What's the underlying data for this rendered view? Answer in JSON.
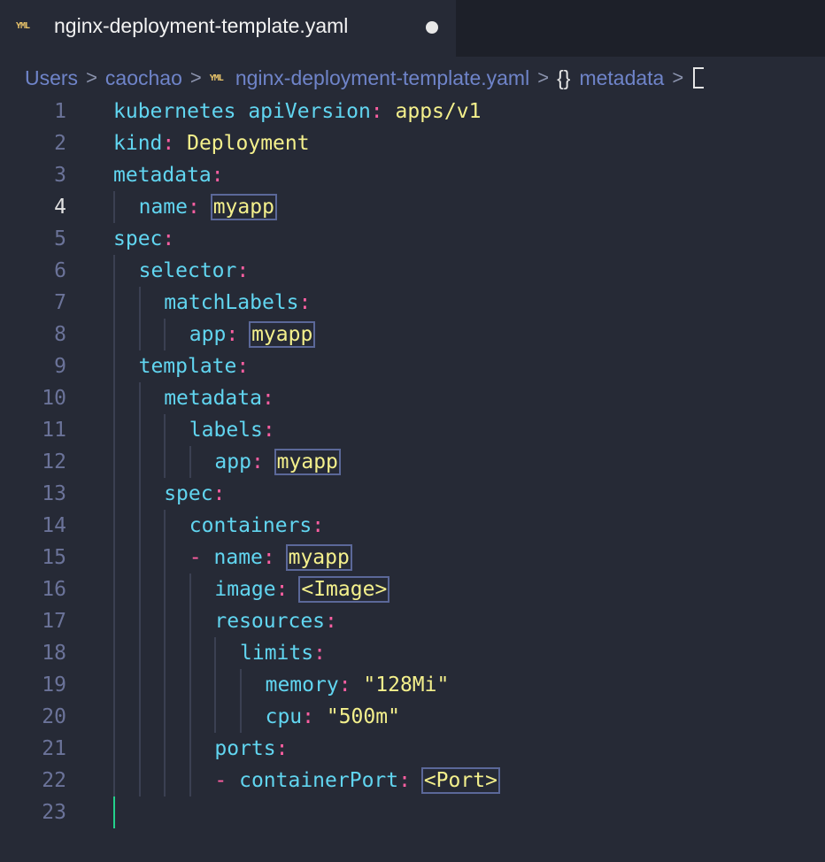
{
  "tab": {
    "icon_text": "YML",
    "title": "nginx-deployment-template.yaml"
  },
  "breadcrumb": {
    "items": [
      "Users",
      "caochao",
      "nginx-deployment-template.yaml",
      "metadata"
    ],
    "file_icon_text": "YML",
    "object_icon_text": "{}"
  },
  "editor": {
    "active_line": 4,
    "lines": [
      {
        "num": "1",
        "indent": 0,
        "key": "kubernetes apiVersion",
        "val": "apps/v1"
      },
      {
        "num": "2",
        "indent": 0,
        "key": "kind",
        "val": "Deployment"
      },
      {
        "num": "3",
        "indent": 0,
        "key": "metadata"
      },
      {
        "num": "4",
        "indent": 1,
        "key": "name",
        "val": "myapp",
        "hl": true
      },
      {
        "num": "5",
        "indent": 0,
        "key": "spec"
      },
      {
        "num": "6",
        "indent": 1,
        "key": "selector"
      },
      {
        "num": "7",
        "indent": 2,
        "key": "matchLabels"
      },
      {
        "num": "8",
        "indent": 3,
        "key": "app",
        "val": "myapp",
        "hl": true
      },
      {
        "num": "9",
        "indent": 1,
        "key": "template"
      },
      {
        "num": "10",
        "indent": 2,
        "key": "metadata"
      },
      {
        "num": "11",
        "indent": 3,
        "key": "labels"
      },
      {
        "num": "12",
        "indent": 4,
        "key": "app",
        "val": "myapp",
        "hl": true
      },
      {
        "num": "13",
        "indent": 2,
        "key": "spec"
      },
      {
        "num": "14",
        "indent": 3,
        "key": "containers"
      },
      {
        "num": "15",
        "indent": 3,
        "dash": true,
        "key": "name",
        "val": "myapp",
        "hl": true
      },
      {
        "num": "16",
        "indent": 4,
        "key": "image",
        "val": "<Image>",
        "hl": true
      },
      {
        "num": "17",
        "indent": 4,
        "key": "resources"
      },
      {
        "num": "18",
        "indent": 5,
        "key": "limits"
      },
      {
        "num": "19",
        "indent": 6,
        "key": "memory",
        "val": "\"128Mi\""
      },
      {
        "num": "20",
        "indent": 6,
        "key": "cpu",
        "val": "\"500m\""
      },
      {
        "num": "21",
        "indent": 4,
        "key": "ports"
      },
      {
        "num": "22",
        "indent": 4,
        "dash": true,
        "key": "containerPort",
        "val": "<Port>",
        "hl": true
      },
      {
        "num": "23",
        "indent": 0,
        "cursor": true
      }
    ]
  },
  "colors": {
    "background": "#262a36",
    "key": "#61d5f0",
    "punctuation": "#ff5fa2",
    "value": "#f4f08c",
    "line_number": "#6b7399",
    "cursor": "#23d18b"
  }
}
